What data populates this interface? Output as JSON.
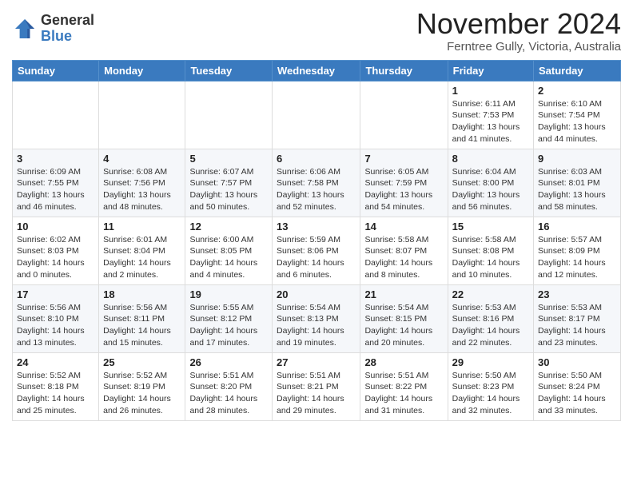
{
  "header": {
    "logo_general": "General",
    "logo_blue": "Blue",
    "month_title": "November 2024",
    "location": "Ferntree Gully, Victoria, Australia"
  },
  "days_of_week": [
    "Sunday",
    "Monday",
    "Tuesday",
    "Wednesday",
    "Thursday",
    "Friday",
    "Saturday"
  ],
  "weeks": [
    [
      {
        "day": "",
        "info": ""
      },
      {
        "day": "",
        "info": ""
      },
      {
        "day": "",
        "info": ""
      },
      {
        "day": "",
        "info": ""
      },
      {
        "day": "",
        "info": ""
      },
      {
        "day": "1",
        "info": "Sunrise: 6:11 AM\nSunset: 7:53 PM\nDaylight: 13 hours\nand 41 minutes."
      },
      {
        "day": "2",
        "info": "Sunrise: 6:10 AM\nSunset: 7:54 PM\nDaylight: 13 hours\nand 44 minutes."
      }
    ],
    [
      {
        "day": "3",
        "info": "Sunrise: 6:09 AM\nSunset: 7:55 PM\nDaylight: 13 hours\nand 46 minutes."
      },
      {
        "day": "4",
        "info": "Sunrise: 6:08 AM\nSunset: 7:56 PM\nDaylight: 13 hours\nand 48 minutes."
      },
      {
        "day": "5",
        "info": "Sunrise: 6:07 AM\nSunset: 7:57 PM\nDaylight: 13 hours\nand 50 minutes."
      },
      {
        "day": "6",
        "info": "Sunrise: 6:06 AM\nSunset: 7:58 PM\nDaylight: 13 hours\nand 52 minutes."
      },
      {
        "day": "7",
        "info": "Sunrise: 6:05 AM\nSunset: 7:59 PM\nDaylight: 13 hours\nand 54 minutes."
      },
      {
        "day": "8",
        "info": "Sunrise: 6:04 AM\nSunset: 8:00 PM\nDaylight: 13 hours\nand 56 minutes."
      },
      {
        "day": "9",
        "info": "Sunrise: 6:03 AM\nSunset: 8:01 PM\nDaylight: 13 hours\nand 58 minutes."
      }
    ],
    [
      {
        "day": "10",
        "info": "Sunrise: 6:02 AM\nSunset: 8:03 PM\nDaylight: 14 hours\nand 0 minutes."
      },
      {
        "day": "11",
        "info": "Sunrise: 6:01 AM\nSunset: 8:04 PM\nDaylight: 14 hours\nand 2 minutes."
      },
      {
        "day": "12",
        "info": "Sunrise: 6:00 AM\nSunset: 8:05 PM\nDaylight: 14 hours\nand 4 minutes."
      },
      {
        "day": "13",
        "info": "Sunrise: 5:59 AM\nSunset: 8:06 PM\nDaylight: 14 hours\nand 6 minutes."
      },
      {
        "day": "14",
        "info": "Sunrise: 5:58 AM\nSunset: 8:07 PM\nDaylight: 14 hours\nand 8 minutes."
      },
      {
        "day": "15",
        "info": "Sunrise: 5:58 AM\nSunset: 8:08 PM\nDaylight: 14 hours\nand 10 minutes."
      },
      {
        "day": "16",
        "info": "Sunrise: 5:57 AM\nSunset: 8:09 PM\nDaylight: 14 hours\nand 12 minutes."
      }
    ],
    [
      {
        "day": "17",
        "info": "Sunrise: 5:56 AM\nSunset: 8:10 PM\nDaylight: 14 hours\nand 13 minutes."
      },
      {
        "day": "18",
        "info": "Sunrise: 5:56 AM\nSunset: 8:11 PM\nDaylight: 14 hours\nand 15 minutes."
      },
      {
        "day": "19",
        "info": "Sunrise: 5:55 AM\nSunset: 8:12 PM\nDaylight: 14 hours\nand 17 minutes."
      },
      {
        "day": "20",
        "info": "Sunrise: 5:54 AM\nSunset: 8:13 PM\nDaylight: 14 hours\nand 19 minutes."
      },
      {
        "day": "21",
        "info": "Sunrise: 5:54 AM\nSunset: 8:15 PM\nDaylight: 14 hours\nand 20 minutes."
      },
      {
        "day": "22",
        "info": "Sunrise: 5:53 AM\nSunset: 8:16 PM\nDaylight: 14 hours\nand 22 minutes."
      },
      {
        "day": "23",
        "info": "Sunrise: 5:53 AM\nSunset: 8:17 PM\nDaylight: 14 hours\nand 23 minutes."
      }
    ],
    [
      {
        "day": "24",
        "info": "Sunrise: 5:52 AM\nSunset: 8:18 PM\nDaylight: 14 hours\nand 25 minutes."
      },
      {
        "day": "25",
        "info": "Sunrise: 5:52 AM\nSunset: 8:19 PM\nDaylight: 14 hours\nand 26 minutes."
      },
      {
        "day": "26",
        "info": "Sunrise: 5:51 AM\nSunset: 8:20 PM\nDaylight: 14 hours\nand 28 minutes."
      },
      {
        "day": "27",
        "info": "Sunrise: 5:51 AM\nSunset: 8:21 PM\nDaylight: 14 hours\nand 29 minutes."
      },
      {
        "day": "28",
        "info": "Sunrise: 5:51 AM\nSunset: 8:22 PM\nDaylight: 14 hours\nand 31 minutes."
      },
      {
        "day": "29",
        "info": "Sunrise: 5:50 AM\nSunset: 8:23 PM\nDaylight: 14 hours\nand 32 minutes."
      },
      {
        "day": "30",
        "info": "Sunrise: 5:50 AM\nSunset: 8:24 PM\nDaylight: 14 hours\nand 33 minutes."
      }
    ]
  ]
}
